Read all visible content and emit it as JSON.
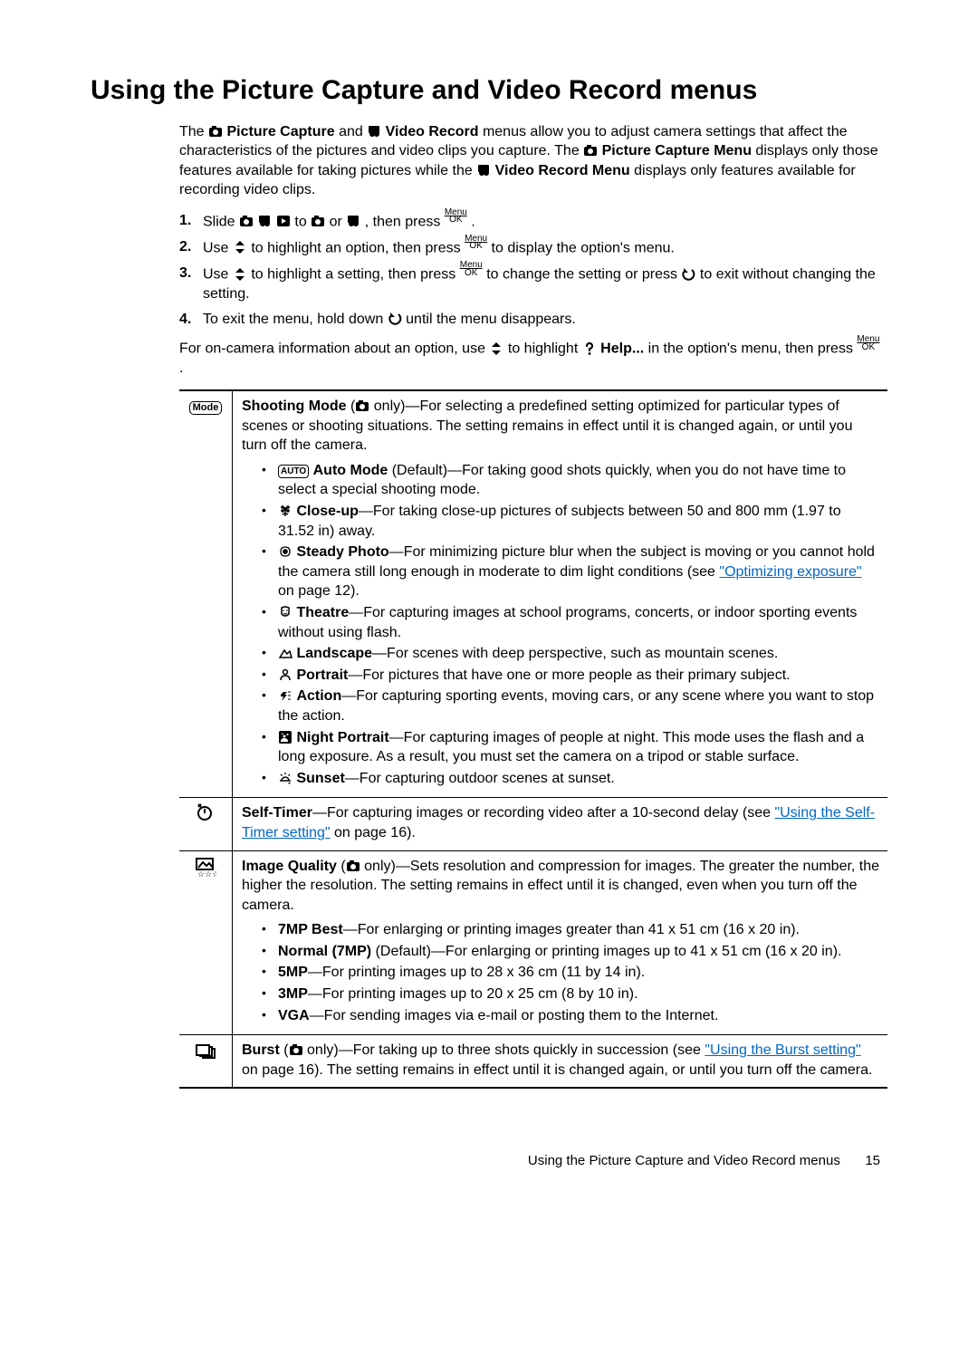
{
  "title": "Using the Picture Capture and Video Record menus",
  "intro": {
    "t1": "The ",
    "pc": "Picture Capture",
    "t2": " and ",
    "vr": "Video Record",
    "t3": " menus allow you to adjust camera settings that affect the characteristics of the pictures and video clips you capture. The ",
    "pcm": "Picture Capture Menu",
    "t4": " displays only those features available for taking pictures while the ",
    "vrm": "Video Record Menu",
    "t5": " displays only features available for recording video clips."
  },
  "steps": {
    "n1": "1.",
    "s1a": "Slide ",
    "s1b": " to ",
    "s1c": " or ",
    "s1d": ", then press ",
    "s1e": ".",
    "n2": "2.",
    "s2a": "Use ",
    "s2b": " to highlight an option, then press ",
    "s2c": " to display the option's menu.",
    "n3": "3.",
    "s3a": "Use ",
    "s3b": " to highlight a setting, then press ",
    "s3c": " to change the setting or press ",
    "s3d": " to exit without changing the setting.",
    "n4": "4.",
    "s4a": "To exit the menu, hold down ",
    "s4b": " until the menu disappears."
  },
  "after": {
    "a1": "For on-camera information about an option, use ",
    "a2": " to highlight ",
    "help": "Help...",
    "a3": " in the option's menu, then press ",
    "a4": "."
  },
  "shooting": {
    "lead1": "Shooting Mode",
    "lead2": " only)—For selecting a predefined setting optimized for particular types of scenes or shooting situations. The setting remains in effect until it is changed again, or until you turn off the camera.",
    "auto_b": "Auto Mode",
    "auto_t": " (Default)—For taking good shots quickly, when you do not have time to select a special shooting mode.",
    "close_b": "Close-up",
    "close_t": "—For taking close-up pictures of subjects between 50 and 800 mm (1.97 to 31.52 in) away.",
    "steady_b": "Steady Photo",
    "steady_t1": "—For minimizing picture blur when the subject is moving or you cannot hold the camera still long enough in moderate to dim light conditions (see ",
    "steady_link": "\"Optimizing exposure\"",
    "steady_t2": " on page 12).",
    "theatre_b": "Theatre",
    "theatre_t": "—For capturing images at school programs, concerts, or indoor sporting events without using flash.",
    "land_b": "Landscape",
    "land_t": "—For scenes with deep perspective, such as mountain scenes.",
    "port_b": "Portrait",
    "port_t": "—For pictures that have one or more people as their primary subject.",
    "act_b": "Action",
    "act_t": "—For capturing sporting events, moving cars, or any scene where you want to stop the action.",
    "np_b": "Night Portrait",
    "np_t": "—For capturing images of people at night. This mode uses the flash and a long exposure. As a result, you must set the camera on a tripod or stable surface.",
    "sun_b": "Sunset",
    "sun_t": "—For capturing outdoor scenes at sunset."
  },
  "selftimer": {
    "lead": "Self-Timer",
    "t1": "—For capturing images or recording video after a 10-second delay (see ",
    "link": "\"Using the Self-Timer setting\"",
    "t2": " on page 16)."
  },
  "iq": {
    "lead": "Image Quality",
    "t1": " only)—Sets resolution and compression for images. The greater the number, the higher the resolution. The setting remains in effect until it is changed, even when you turn off the camera.",
    "b1": "7MP Best",
    "t_b1": "—For enlarging or printing images greater than 41 x 51 cm (16 x 20 in).",
    "b2": "Normal (7MP)",
    "t_b2": " (Default)—For enlarging or printing images up to 41 x 51 cm (16 x 20 in).",
    "b3": "5MP",
    "t_b3": "—For printing images up to 28 x 36 cm (11 by 14 in).",
    "b4": "3MP",
    "t_b4": "—For printing images up to 20 x 25 cm (8 by 10 in).",
    "b5": "VGA",
    "t_b5": "—For sending images via e-mail or posting them to the Internet."
  },
  "burst": {
    "lead": "Burst",
    "t1": " only)—For taking up to three shots quickly in succession (see ",
    "link": "\"Using the Burst setting\"",
    "t2": " on page 16). The setting remains in effect until it is changed again, or until you turn off the camera."
  },
  "menuok": {
    "m": "Menu",
    "o": "OK"
  },
  "chips": {
    "mode": "Mode",
    "auto": "AUTO"
  },
  "footer": {
    "label": "Using the Picture Capture and Video Record menus",
    "page": "15"
  }
}
